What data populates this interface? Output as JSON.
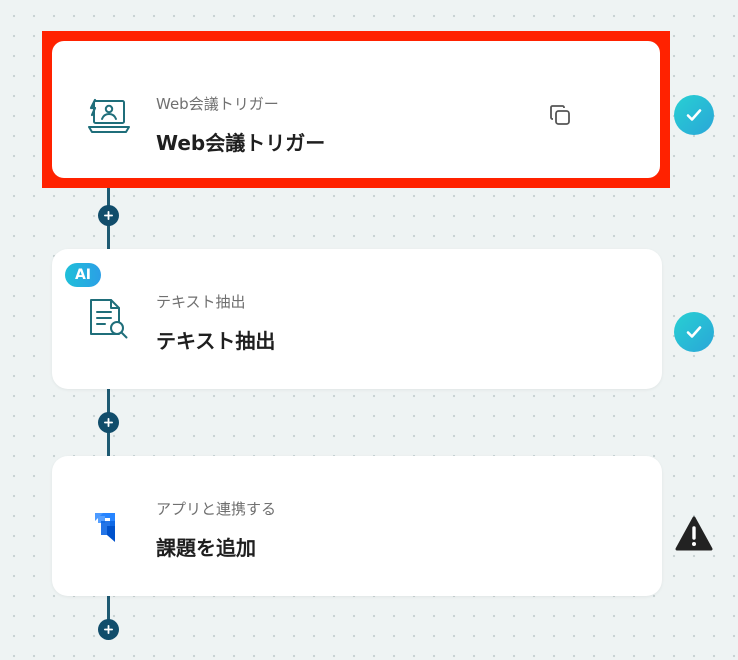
{
  "flow": {
    "steps": [
      {
        "subtitle": "Web会議トリガー",
        "title": "Web会議トリガー",
        "icon": "web-meeting-icon",
        "status": "complete"
      },
      {
        "badge": "AI",
        "subtitle": "テキスト抽出",
        "title": "テキスト抽出",
        "icon": "text-extraction-icon",
        "status": "complete"
      },
      {
        "subtitle": "アプリと連携する",
        "title": "課題を追加",
        "icon": "jira-icon",
        "status": "warning"
      }
    ]
  },
  "colors": {
    "selection_border": "#ff2200",
    "connector": "#114d6b",
    "status_complete": "#27c2d6",
    "status_warning": "#222222",
    "icon_teal": "#1f6e7a",
    "jira_blue": "#2684ff"
  }
}
